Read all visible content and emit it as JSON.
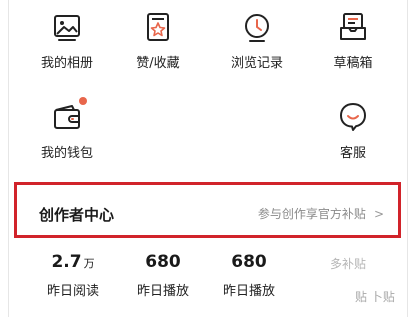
{
  "menu_row1": [
    {
      "label": "我的相册",
      "icon": "photo-album-icon"
    },
    {
      "label": "赞/收藏",
      "icon": "like-collection-icon"
    },
    {
      "label": "浏览记录",
      "icon": "history-clock-icon"
    },
    {
      "label": "草稿箱",
      "icon": "drafts-box-icon"
    }
  ],
  "menu_row2": [
    {
      "label": "我的钱包",
      "icon": "wallet-icon",
      "badge": true
    },
    {
      "label": "客服",
      "icon": "customer-service-icon"
    }
  ],
  "creator": {
    "title": "创作者中心",
    "link_label": "参与创作享官方补贴",
    "chevron": ">"
  },
  "stats": [
    {
      "value": "2.7",
      "unit": "万",
      "caption": "昨日阅读"
    },
    {
      "value": "680",
      "unit": "",
      "caption": "昨日播放"
    },
    {
      "value": "680",
      "unit": "",
      "caption": "昨日播放"
    }
  ],
  "subsidy_hint": "多补贴",
  "watermark_text": "贴 卜贴",
  "colors": {
    "highlight_border": "#d1232a",
    "badge": "#e8664b",
    "muted_text": "#8a8a8a"
  }
}
